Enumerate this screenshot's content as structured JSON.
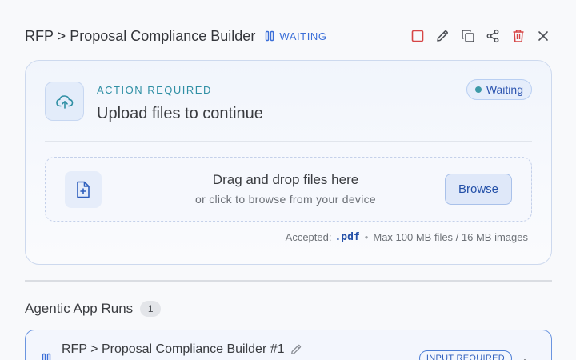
{
  "header": {
    "title": "RFP > Proposal Compliance Builder",
    "status": "WAITING"
  },
  "toolbar": {
    "icons": [
      "stop-icon",
      "pencil-icon",
      "copy-icon",
      "share-icon",
      "trash-icon",
      "close-icon"
    ]
  },
  "upload_card": {
    "action_label": "ACTION REQUIRED",
    "title": "Upload files to continue",
    "badge": "Waiting",
    "dropzone_title": "Drag and drop files here",
    "dropzone_subtitle": "or click to browse from your device",
    "browse_label": "Browse",
    "accepted_label": "Accepted:",
    "accepted_ext": ".pdf",
    "limits": "Max 100 MB files / 16 MB images"
  },
  "runs": {
    "title": "Agentic App Runs",
    "count": "1",
    "items": [
      {
        "title": "RFP > Proposal Compliance Builder #1",
        "badge": "INPUT REQUIRED"
      }
    ]
  },
  "colors": {
    "accent": "#3b6fd8",
    "teal": "#2f8fa4",
    "danger": "#d64545"
  }
}
